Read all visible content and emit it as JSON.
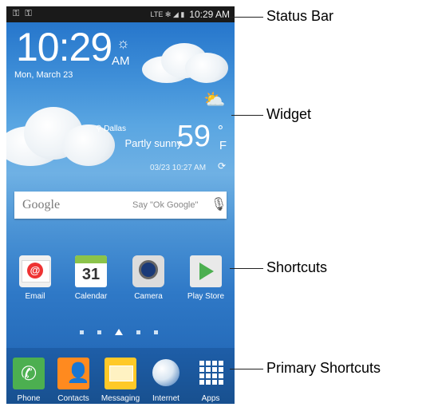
{
  "status_bar": {
    "left_icons": "⚿ ⚿",
    "network": "LTE ✻ ◢ ▮",
    "time": "10:29 AM"
  },
  "clock": {
    "time": "10:29",
    "ampm": "AM",
    "date": "Mon, March 23"
  },
  "weather": {
    "location": "Dallas",
    "condition": "Partly sunny",
    "temp": "59",
    "degree": "°",
    "unit": "F",
    "updated": "03/23 10:27 AM"
  },
  "search": {
    "brand": "Google",
    "hint": "Say \"Ok Google\""
  },
  "shortcuts": [
    {
      "label": "Email"
    },
    {
      "label": "Calendar",
      "day": "31"
    },
    {
      "label": "Camera"
    },
    {
      "label": "Play Store"
    }
  ],
  "dock": [
    {
      "label": "Phone"
    },
    {
      "label": "Contacts"
    },
    {
      "label": "Messaging"
    },
    {
      "label": "Internet"
    },
    {
      "label": "Apps"
    }
  ],
  "callouts": {
    "status_bar": "Status Bar",
    "widget": "Widget",
    "shortcuts": "Shortcuts",
    "primary": "Primary Shortcuts"
  }
}
